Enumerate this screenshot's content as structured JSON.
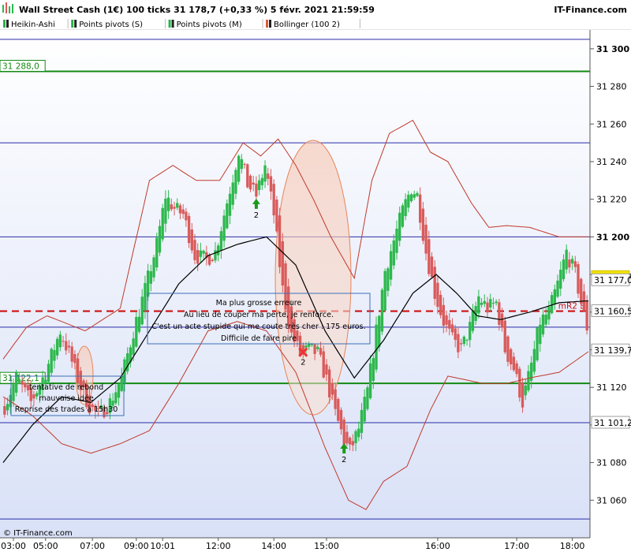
{
  "header": {
    "title": "Wall Street Cash (1€) 100 ticks 31 178,7 (+0,33 %) 5 févr. 2021 21:59:59",
    "brand": "IT-Finance.com",
    "indicators": [
      "Heikin-Ashi",
      "Points pivots (S)",
      "Points pivots (M)",
      "Bollinger (100 2)"
    ],
    "indicator_colors": [
      "#2bb24c",
      "#2bb24c",
      "#2bb24c",
      "#e05a3c"
    ]
  },
  "footer": {
    "copyright": "© IT-Finance.com"
  },
  "colors": {
    "up": "#2db84d",
    "down": "#d95b5b",
    "bollinger": "#c0392b",
    "middle_band": "#000000",
    "pivot_blue": "#2b2ba8",
    "pivot_green": "#138a13",
    "pivot_red": "#cc1111",
    "background_top": "#ffffff",
    "background_bottom": "#d9e1f7"
  },
  "chart_data": {
    "type": "candlestick",
    "style": "heikin-ashi",
    "ylim": [
      31040,
      31310
    ],
    "y_ticks": [
      31060,
      31080,
      31100,
      31120,
      31140,
      31160,
      31180,
      31200,
      31220,
      31240,
      31260,
      31280,
      31300
    ],
    "y_tick_labels": [
      "31 060",
      "31 080",
      "31 100",
      "31 120",
      "31 140",
      "31 160",
      "31 180",
      "31 200",
      "31 220",
      "31 240",
      "31 260",
      "31 280",
      "31 300"
    ],
    "y_bold_ticks": [
      "31 200",
      "31 300"
    ],
    "x_tick_labels": [
      "03:00",
      "05:00",
      "07:00",
      "09:00",
      "10:01",
      "12:00",
      "14:00",
      "15:00",
      "16:00",
      "17:00",
      "18:00"
    ],
    "price_path": [
      [
        0,
        31110
      ],
      [
        4,
        31125
      ],
      [
        9,
        31112
      ],
      [
        14,
        31128
      ],
      [
        19,
        31150
      ],
      [
        22,
        31138
      ],
      [
        26,
        31120
      ],
      [
        29,
        31110
      ],
      [
        32,
        31105
      ],
      [
        36,
        31112
      ],
      [
        40,
        31125
      ],
      [
        44,
        31150
      ],
      [
        48,
        31172
      ],
      [
        52,
        31196
      ],
      [
        55,
        31222
      ],
      [
        58,
        31215
      ],
      [
        61,
        31212
      ],
      [
        65,
        31190
      ],
      [
        69,
        31188
      ],
      [
        72,
        31192
      ],
      [
        75,
        31212
      ],
      [
        78,
        31232
      ],
      [
        80,
        31246
      ],
      [
        83,
        31228
      ],
      [
        86,
        31222
      ],
      [
        89,
        31238
      ],
      [
        92,
        31212
      ],
      [
        95,
        31172
      ],
      [
        98,
        31148
      ],
      [
        101,
        31138
      ],
      [
        104,
        31140
      ],
      [
        107,
        31138
      ],
      [
        110,
        31124
      ],
      [
        113,
        31106
      ],
      [
        116,
        31092
      ],
      [
        118,
        31086
      ],
      [
        121,
        31098
      ],
      [
        124,
        31118
      ],
      [
        127,
        31150
      ],
      [
        130,
        31182
      ],
      [
        133,
        31198
      ],
      [
        136,
        31214
      ],
      [
        139,
        31226
      ],
      [
        141,
        31222
      ],
      [
        144,
        31192
      ],
      [
        147,
        31170
      ],
      [
        150,
        31155
      ],
      [
        153,
        31145
      ],
      [
        156,
        31140
      ],
      [
        159,
        31152
      ],
      [
        162,
        31168
      ],
      [
        165,
        31162
      ],
      [
        168,
        31165
      ],
      [
        171,
        31140
      ],
      [
        174,
        31130
      ],
      [
        177,
        31112
      ],
      [
        180,
        31132
      ],
      [
        183,
        31155
      ],
      [
        186,
        31160
      ],
      [
        189,
        31175
      ],
      [
        192,
        31192
      ],
      [
        195,
        31180
      ],
      [
        197,
        31165
      ],
      [
        199,
        31152
      ],
      [
        200,
        31172
      ]
    ],
    "candle_count": 200,
    "bollinger": {
      "period": 100,
      "deviations": 2,
      "middle": [
        [
          0,
          31080
        ],
        [
          10,
          31100
        ],
        [
          20,
          31115
        ],
        [
          30,
          31112
        ],
        [
          40,
          31125
        ],
        [
          50,
          31150
        ],
        [
          60,
          31175
        ],
        [
          70,
          31190
        ],
        [
          80,
          31196
        ],
        [
          90,
          31200
        ],
        [
          100,
          31185
        ],
        [
          110,
          31150
        ],
        [
          120,
          31125
        ],
        [
          130,
          31145
        ],
        [
          140,
          31170
        ],
        [
          148,
          31180
        ],
        [
          155,
          31170
        ],
        [
          162,
          31158
        ],
        [
          170,
          31156
        ],
        [
          180,
          31160
        ],
        [
          190,
          31165
        ],
        [
          200,
          31166
        ]
      ],
      "upper": [
        [
          0,
          31135
        ],
        [
          8,
          31152
        ],
        [
          15,
          31158
        ],
        [
          20,
          31155
        ],
        [
          28,
          31150
        ],
        [
          40,
          31162
        ],
        [
          50,
          31230
        ],
        [
          58,
          31238
        ],
        [
          66,
          31230
        ],
        [
          74,
          31230
        ],
        [
          82,
          31250
        ],
        [
          88,
          31243
        ],
        [
          94,
          31252
        ],
        [
          100,
          31238
        ],
        [
          106,
          31220
        ],
        [
          112,
          31200
        ],
        [
          120,
          31178
        ],
        [
          126,
          31230
        ],
        [
          132,
          31255
        ],
        [
          140,
          31262
        ],
        [
          146,
          31245
        ],
        [
          152,
          31240
        ],
        [
          160,
          31218
        ],
        [
          166,
          31205
        ],
        [
          172,
          31206
        ],
        [
          180,
          31205
        ],
        [
          190,
          31200
        ],
        [
          200,
          31200
        ]
      ],
      "lower": [
        [
          0,
          31115
        ],
        [
          10,
          31105
        ],
        [
          20,
          31090
        ],
        [
          30,
          31085
        ],
        [
          40,
          31090
        ],
        [
          50,
          31097
        ],
        [
          60,
          31122
        ],
        [
          70,
          31150
        ],
        [
          80,
          31155
        ],
        [
          90,
          31150
        ],
        [
          100,
          31128
        ],
        [
          110,
          31088
        ],
        [
          118,
          31060
        ],
        [
          124,
          31055
        ],
        [
          130,
          31070
        ],
        [
          138,
          31078
        ],
        [
          146,
          31108
        ],
        [
          152,
          31126
        ],
        [
          158,
          31124
        ],
        [
          164,
          31122
        ],
        [
          172,
          31122
        ],
        [
          180,
          31125
        ],
        [
          190,
          31128
        ],
        [
          200,
          31139
        ]
      ]
    },
    "horizontal_levels": [
      {
        "price": 31305,
        "color": "#2b2ba8",
        "style": "solid"
      },
      {
        "price": 31288.0,
        "color": "#138a13",
        "style": "solid",
        "label": "31 288,0",
        "label_side": "left"
      },
      {
        "price": 31250,
        "color": "#2b2ba8",
        "style": "solid"
      },
      {
        "price": 31200,
        "color": "#2b2ba8",
        "style": "solid"
      },
      {
        "price": 31160.5,
        "color": "#cc1111",
        "style": "dashed",
        "label": "mR2 S"
      },
      {
        "price": 31152,
        "color": "#2b2ba8",
        "style": "solid"
      },
      {
        "price": 31122.1,
        "color": "#138a13",
        "style": "solid",
        "label": "31 122,1",
        "label_side": "left"
      },
      {
        "price": 31101.2,
        "color": "#2b2ba8",
        "style": "solid"
      },
      {
        "price": 31050,
        "color": "#2b2ba8",
        "style": "solid"
      }
    ],
    "price_tags": [
      {
        "price": 31178.7,
        "label": "31 178,7",
        "bg": "#f2e205",
        "fg": "#000000"
      },
      {
        "price": 31177.0,
        "label": "31 177,0",
        "bg": "#ffffff",
        "fg": "#000000"
      },
      {
        "price": 31160.5,
        "label": "31 160,5",
        "bg": "#ffffff",
        "fg": "#cc1111"
      },
      {
        "price": 31139.7,
        "label": "31 139,7",
        "bg": "#ffffff",
        "fg": "#000000"
      },
      {
        "price": 31101.2,
        "label": "31 101,2",
        "bg": "#ffffff",
        "fg": "#cc1111"
      }
    ],
    "annotations": [
      {
        "lines": [
          "Ma plus grosse erreure",
          "Au lieu de couper ma perte, je renforce.",
          "C'est un acte stupide qui me coute très cher : 175 euros.",
          "Difficile de faire pire"
        ]
      },
      {
        "lines": [
          "tentative de rebond",
          "mauvaise idée",
          "Reprise des trades à 15h30"
        ]
      }
    ],
    "markers": [
      {
        "candle": 86,
        "type": "buy",
        "label": "2"
      },
      {
        "candle": 102,
        "type": "close",
        "label": "2"
      },
      {
        "candle": 116,
        "type": "buy",
        "label": "2"
      }
    ]
  }
}
